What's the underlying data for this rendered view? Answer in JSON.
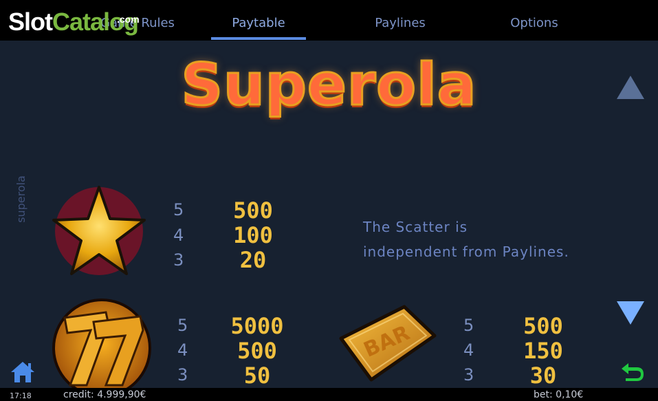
{
  "brand": {
    "logo_main": "Slot",
    "logo_accent": "Catalog",
    "logo_suffix": ".com"
  },
  "tabs": [
    {
      "label": "Game Rules"
    },
    {
      "label": "Paytable",
      "active": true
    },
    {
      "label": "Paylines"
    },
    {
      "label": "Options"
    }
  ],
  "game_title": "Superola",
  "side_label": "superola",
  "paytable": {
    "scatter": {
      "symbol": "star",
      "rows": [
        {
          "count": "5",
          "pay": "500"
        },
        {
          "count": "4",
          "pay": "100"
        },
        {
          "count": "3",
          "pay": "20"
        }
      ],
      "note_line1": "The Scatter is",
      "note_line2": "independent from Paylines."
    },
    "seven": {
      "symbol": "seven",
      "rows": [
        {
          "count": "5",
          "pay": "5000"
        },
        {
          "count": "4",
          "pay": "500"
        },
        {
          "count": "3",
          "pay": "50"
        }
      ]
    },
    "bar": {
      "symbol": "bar",
      "label": "BAR",
      "rows": [
        {
          "count": "5",
          "pay": "500"
        },
        {
          "count": "4",
          "pay": "150"
        },
        {
          "count": "3",
          "pay": "30"
        }
      ]
    }
  },
  "status": {
    "time": "17:18",
    "credit": "credit: 4.999,90€",
    "bet": "bet: 0,10€"
  },
  "icons": {
    "home": "home-icon",
    "back": "back-arrow-icon",
    "up": "scroll-up-icon",
    "down": "scroll-down-icon"
  },
  "colors": {
    "background": "#172130",
    "tab_text": "#7d94c8",
    "payout": "#f0c040",
    "multiplier": "#7b8fbf"
  }
}
